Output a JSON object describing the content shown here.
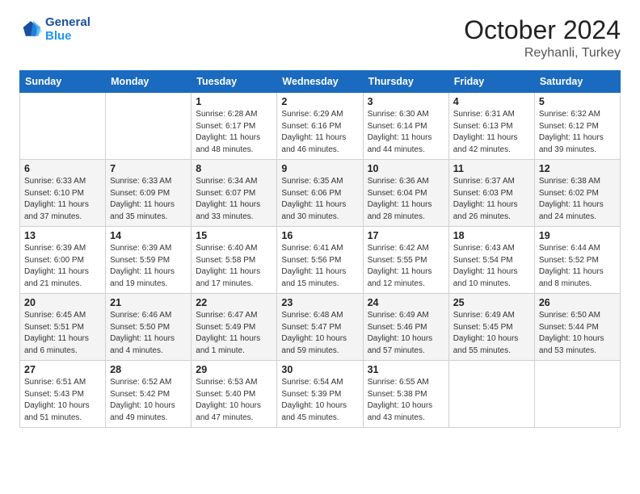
{
  "logo": {
    "line1": "General",
    "line2": "Blue"
  },
  "title": "October 2024",
  "location": "Reyhanli, Turkey",
  "header_days": [
    "Sunday",
    "Monday",
    "Tuesday",
    "Wednesday",
    "Thursday",
    "Friday",
    "Saturday"
  ],
  "weeks": [
    [
      {
        "day": "",
        "sunrise": "",
        "sunset": "",
        "daylight": ""
      },
      {
        "day": "",
        "sunrise": "",
        "sunset": "",
        "daylight": ""
      },
      {
        "day": "1",
        "sunrise": "Sunrise: 6:28 AM",
        "sunset": "Sunset: 6:17 PM",
        "daylight": "Daylight: 11 hours and 48 minutes."
      },
      {
        "day": "2",
        "sunrise": "Sunrise: 6:29 AM",
        "sunset": "Sunset: 6:16 PM",
        "daylight": "Daylight: 11 hours and 46 minutes."
      },
      {
        "day": "3",
        "sunrise": "Sunrise: 6:30 AM",
        "sunset": "Sunset: 6:14 PM",
        "daylight": "Daylight: 11 hours and 44 minutes."
      },
      {
        "day": "4",
        "sunrise": "Sunrise: 6:31 AM",
        "sunset": "Sunset: 6:13 PM",
        "daylight": "Daylight: 11 hours and 42 minutes."
      },
      {
        "day": "5",
        "sunrise": "Sunrise: 6:32 AM",
        "sunset": "Sunset: 6:12 PM",
        "daylight": "Daylight: 11 hours and 39 minutes."
      }
    ],
    [
      {
        "day": "6",
        "sunrise": "Sunrise: 6:33 AM",
        "sunset": "Sunset: 6:10 PM",
        "daylight": "Daylight: 11 hours and 37 minutes."
      },
      {
        "day": "7",
        "sunrise": "Sunrise: 6:33 AM",
        "sunset": "Sunset: 6:09 PM",
        "daylight": "Daylight: 11 hours and 35 minutes."
      },
      {
        "day": "8",
        "sunrise": "Sunrise: 6:34 AM",
        "sunset": "Sunset: 6:07 PM",
        "daylight": "Daylight: 11 hours and 33 minutes."
      },
      {
        "day": "9",
        "sunrise": "Sunrise: 6:35 AM",
        "sunset": "Sunset: 6:06 PM",
        "daylight": "Daylight: 11 hours and 30 minutes."
      },
      {
        "day": "10",
        "sunrise": "Sunrise: 6:36 AM",
        "sunset": "Sunset: 6:04 PM",
        "daylight": "Daylight: 11 hours and 28 minutes."
      },
      {
        "day": "11",
        "sunrise": "Sunrise: 6:37 AM",
        "sunset": "Sunset: 6:03 PM",
        "daylight": "Daylight: 11 hours and 26 minutes."
      },
      {
        "day": "12",
        "sunrise": "Sunrise: 6:38 AM",
        "sunset": "Sunset: 6:02 PM",
        "daylight": "Daylight: 11 hours and 24 minutes."
      }
    ],
    [
      {
        "day": "13",
        "sunrise": "Sunrise: 6:39 AM",
        "sunset": "Sunset: 6:00 PM",
        "daylight": "Daylight: 11 hours and 21 minutes."
      },
      {
        "day": "14",
        "sunrise": "Sunrise: 6:39 AM",
        "sunset": "Sunset: 5:59 PM",
        "daylight": "Daylight: 11 hours and 19 minutes."
      },
      {
        "day": "15",
        "sunrise": "Sunrise: 6:40 AM",
        "sunset": "Sunset: 5:58 PM",
        "daylight": "Daylight: 11 hours and 17 minutes."
      },
      {
        "day": "16",
        "sunrise": "Sunrise: 6:41 AM",
        "sunset": "Sunset: 5:56 PM",
        "daylight": "Daylight: 11 hours and 15 minutes."
      },
      {
        "day": "17",
        "sunrise": "Sunrise: 6:42 AM",
        "sunset": "Sunset: 5:55 PM",
        "daylight": "Daylight: 11 hours and 12 minutes."
      },
      {
        "day": "18",
        "sunrise": "Sunrise: 6:43 AM",
        "sunset": "Sunset: 5:54 PM",
        "daylight": "Daylight: 11 hours and 10 minutes."
      },
      {
        "day": "19",
        "sunrise": "Sunrise: 6:44 AM",
        "sunset": "Sunset: 5:52 PM",
        "daylight": "Daylight: 11 hours and 8 minutes."
      }
    ],
    [
      {
        "day": "20",
        "sunrise": "Sunrise: 6:45 AM",
        "sunset": "Sunset: 5:51 PM",
        "daylight": "Daylight: 11 hours and 6 minutes."
      },
      {
        "day": "21",
        "sunrise": "Sunrise: 6:46 AM",
        "sunset": "Sunset: 5:50 PM",
        "daylight": "Daylight: 11 hours and 4 minutes."
      },
      {
        "day": "22",
        "sunrise": "Sunrise: 6:47 AM",
        "sunset": "Sunset: 5:49 PM",
        "daylight": "Daylight: 11 hours and 1 minute."
      },
      {
        "day": "23",
        "sunrise": "Sunrise: 6:48 AM",
        "sunset": "Sunset: 5:47 PM",
        "daylight": "Daylight: 10 hours and 59 minutes."
      },
      {
        "day": "24",
        "sunrise": "Sunrise: 6:49 AM",
        "sunset": "Sunset: 5:46 PM",
        "daylight": "Daylight: 10 hours and 57 minutes."
      },
      {
        "day": "25",
        "sunrise": "Sunrise: 6:49 AM",
        "sunset": "Sunset: 5:45 PM",
        "daylight": "Daylight: 10 hours and 55 minutes."
      },
      {
        "day": "26",
        "sunrise": "Sunrise: 6:50 AM",
        "sunset": "Sunset: 5:44 PM",
        "daylight": "Daylight: 10 hours and 53 minutes."
      }
    ],
    [
      {
        "day": "27",
        "sunrise": "Sunrise: 6:51 AM",
        "sunset": "Sunset: 5:43 PM",
        "daylight": "Daylight: 10 hours and 51 minutes."
      },
      {
        "day": "28",
        "sunrise": "Sunrise: 6:52 AM",
        "sunset": "Sunset: 5:42 PM",
        "daylight": "Daylight: 10 hours and 49 minutes."
      },
      {
        "day": "29",
        "sunrise": "Sunrise: 6:53 AM",
        "sunset": "Sunset: 5:40 PM",
        "daylight": "Daylight: 10 hours and 47 minutes."
      },
      {
        "day": "30",
        "sunrise": "Sunrise: 6:54 AM",
        "sunset": "Sunset: 5:39 PM",
        "daylight": "Daylight: 10 hours and 45 minutes."
      },
      {
        "day": "31",
        "sunrise": "Sunrise: 6:55 AM",
        "sunset": "Sunset: 5:38 PM",
        "daylight": "Daylight: 10 hours and 43 minutes."
      },
      {
        "day": "",
        "sunrise": "",
        "sunset": "",
        "daylight": ""
      },
      {
        "day": "",
        "sunrise": "",
        "sunset": "",
        "daylight": ""
      }
    ]
  ]
}
